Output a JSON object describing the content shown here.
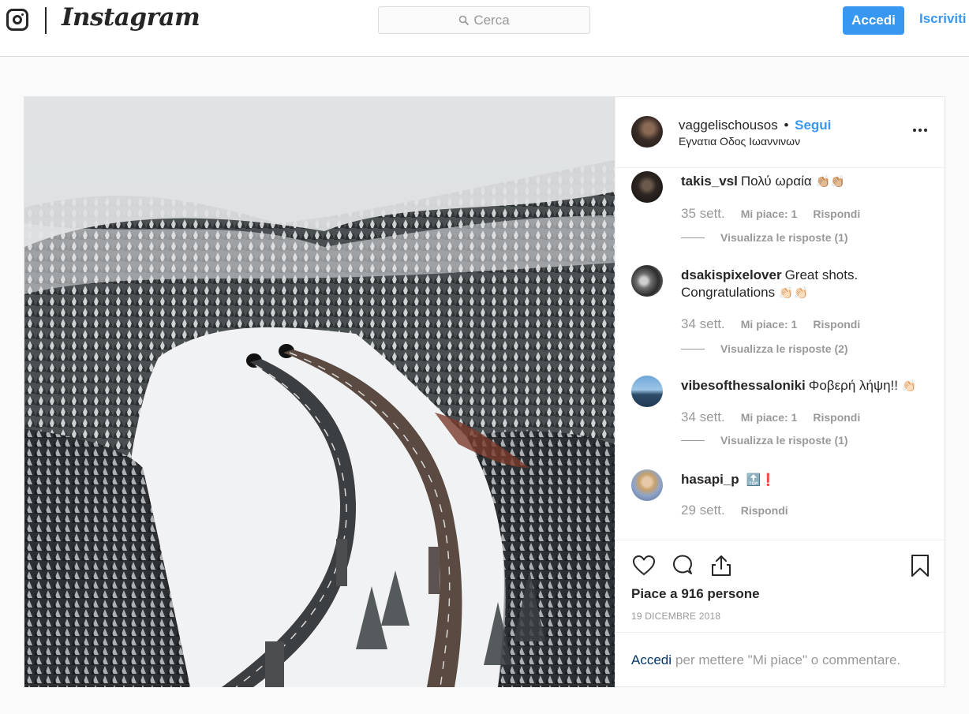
{
  "header": {
    "brand": "Instagram",
    "search_placeholder": "Cerca",
    "login_label": "Accedi",
    "signup_label": "Iscriviti"
  },
  "post": {
    "username": "vaggelischousos",
    "separator": "•",
    "follow_label": "Segui",
    "location": "Εγνατια Οδος Ιωαννινων",
    "likes_text": "Piace a 916 persone",
    "date": "19 DICEMBRE 2018",
    "login_prompt": {
      "link": "Accedi",
      "rest": "per mettere \"Mi piace\" o commentare."
    }
  },
  "comments": [
    {
      "username": "takis_vsl",
      "text": "Πολύ ωραία",
      "emoji": "👏🏼👏🏼",
      "time": "35 sett.",
      "likes": "Mi piace: 1",
      "reply": "Rispondi",
      "view_replies": "Visualizza le risposte (1)"
    },
    {
      "username": "dsakispixelover",
      "text": "Great shots. Congratulations",
      "emoji": "👏🏻👏🏻",
      "time": "34 sett.",
      "likes": "Mi piace: 1",
      "reply": "Rispondi",
      "view_replies": "Visualizza le risposte (2)"
    },
    {
      "username": "vibesofthessaloniki",
      "text": "Φοβερή λήψη!!",
      "emoji": "👏🏻",
      "time": "34 sett.",
      "likes": "Mi piace: 1",
      "reply": "Rispondi",
      "view_replies": "Visualizza le risposte (1)"
    },
    {
      "username": "hasapi_p",
      "text": "",
      "emoji": "🔝❗",
      "time": "29 sett.",
      "reply": "Rispondi"
    }
  ],
  "colors": {
    "accent": "#3897f0",
    "text": "#262626",
    "muted": "#999999",
    "link_dark": "#003569"
  }
}
